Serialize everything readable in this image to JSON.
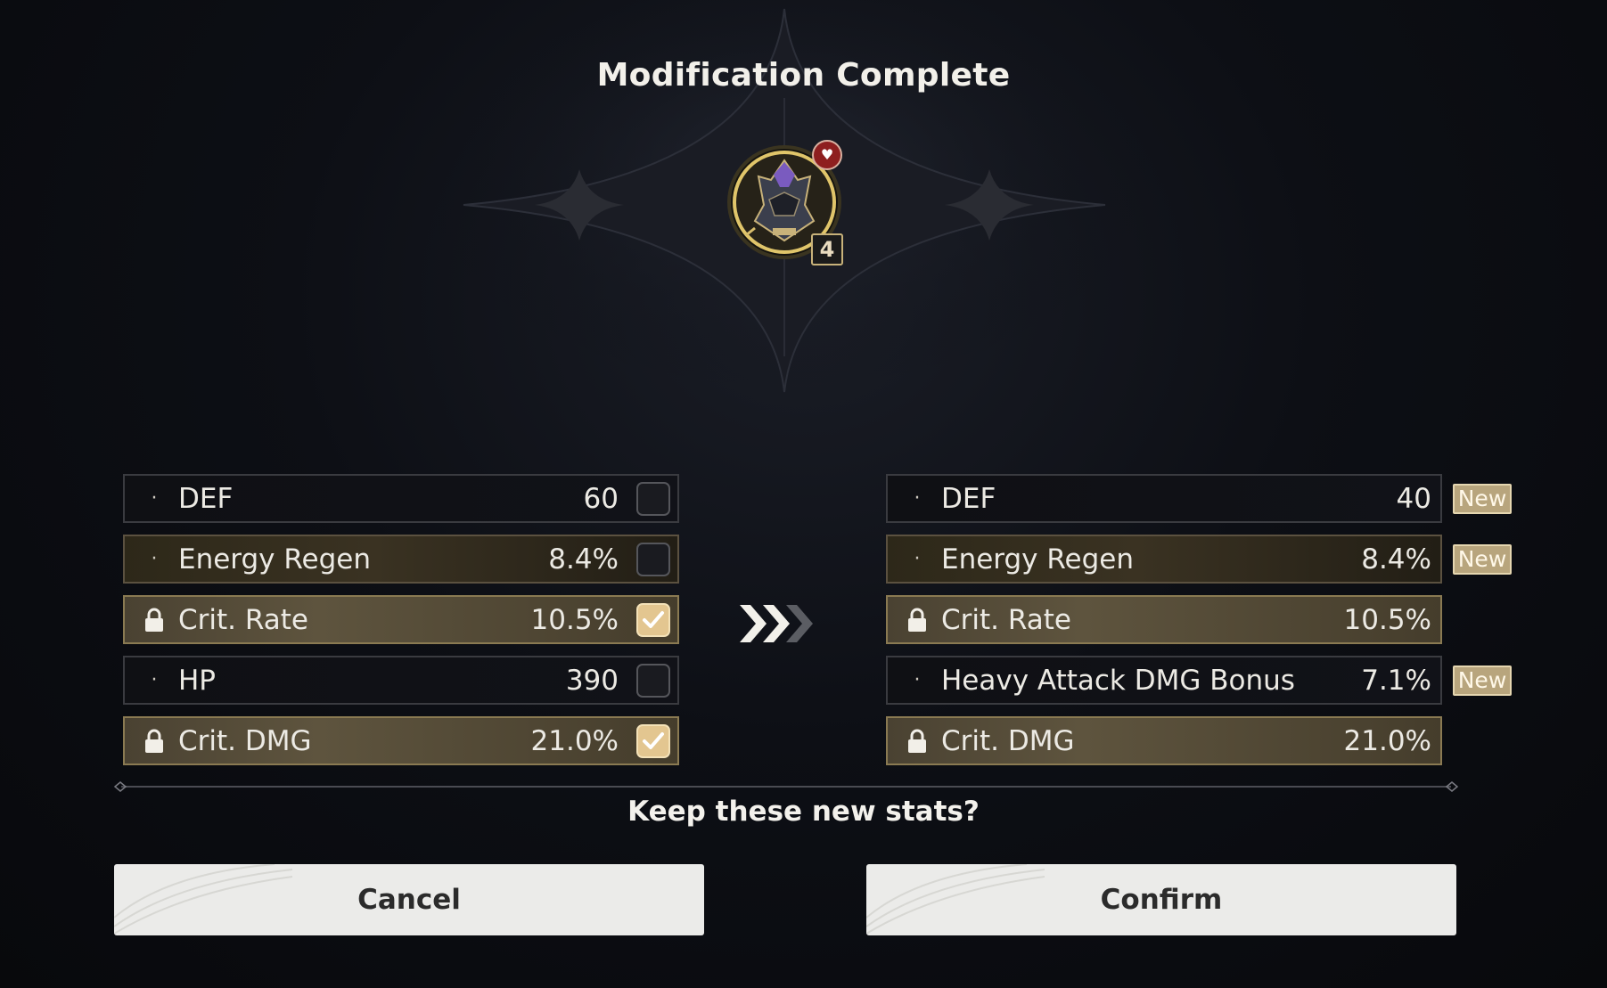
{
  "dialog": {
    "title": "Modification Complete",
    "question": "Keep these new stats?"
  },
  "echo": {
    "level": "4",
    "badge_icon": "heart-shield-icon",
    "icon": "echo-helmet-icon"
  },
  "current_stats": [
    {
      "label": "DEF",
      "value": "60",
      "locked": false,
      "checked": false
    },
    {
      "label": "Energy Regen",
      "value": "8.4%",
      "locked": false,
      "checked": false
    },
    {
      "label": "Crit. Rate",
      "value": "10.5%",
      "locked": true,
      "checked": true
    },
    {
      "label": "HP",
      "value": "390",
      "locked": false,
      "checked": false
    },
    {
      "label": "Crit. DMG",
      "value": "21.0%",
      "locked": true,
      "checked": true
    }
  ],
  "new_stats": [
    {
      "label": "DEF",
      "value": "40",
      "locked": false,
      "new": "New"
    },
    {
      "label": "Energy Regen",
      "value": "8.4%",
      "locked": false,
      "new": "New"
    },
    {
      "label": "Crit. Rate",
      "value": "10.5%",
      "locked": true
    },
    {
      "label": "Heavy Attack DMG Bonus",
      "value": "7.1%",
      "locked": false,
      "new": "New"
    },
    {
      "label": "Crit. DMG",
      "value": "21.0%",
      "locked": true
    }
  ],
  "buttons": {
    "cancel": "Cancel",
    "confirm": "Confirm"
  },
  "colors": {
    "accent_gold": "#e3c690",
    "new_tag": "#b8a57d",
    "background": "#0d0f15"
  }
}
